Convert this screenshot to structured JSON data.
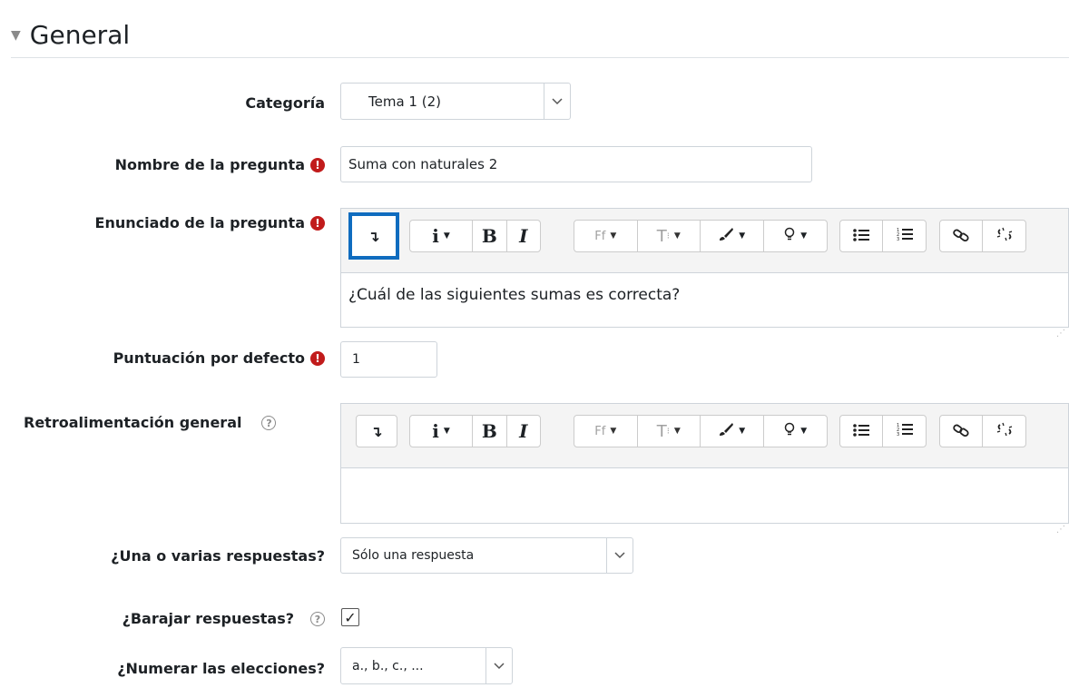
{
  "section": {
    "title": "General",
    "caret_icon": "caret-down-icon"
  },
  "fields": {
    "categoria": {
      "label": "Categoría",
      "value": "Tema 1 (2)"
    },
    "nombre": {
      "label": "Nombre de la pregunta",
      "value": "Suma con naturales 2",
      "required": true
    },
    "enunciado": {
      "label": "Enunciado de la pregunta",
      "content": "¿Cuál de las siguientes sumas es correcta?",
      "required": true
    },
    "puntuacion": {
      "label": "Puntuación por defecto",
      "value": "1",
      "required": true
    },
    "retro": {
      "label": "Retroalimentación general",
      "content": ""
    },
    "una_varias": {
      "label": "¿Una o varias respuestas?",
      "value": "Sólo una respuesta"
    },
    "barajar": {
      "label": "¿Barajar respuestas?",
      "checked": true
    },
    "numerar": {
      "label": "¿Numerar las elecciones?",
      "value": "a., b., c., ..."
    }
  },
  "toolbar": {
    "expand": "↴",
    "info": "i",
    "bold": "B",
    "italic": "I",
    "font": "Ff",
    "size": "T",
    "brush": "brush-icon",
    "bulb": "lightbulb-icon",
    "ul": "unordered-list-icon",
    "ol": "ordered-list-icon",
    "link": "link-icon",
    "unlink": "unlink-icon"
  },
  "icons": {
    "required": "!",
    "help": "?",
    "check": "✓",
    "dropdown": "chevron-down-icon"
  },
  "colors": {
    "required": "#c11b1b",
    "highlight": "#0f6cbf"
  }
}
